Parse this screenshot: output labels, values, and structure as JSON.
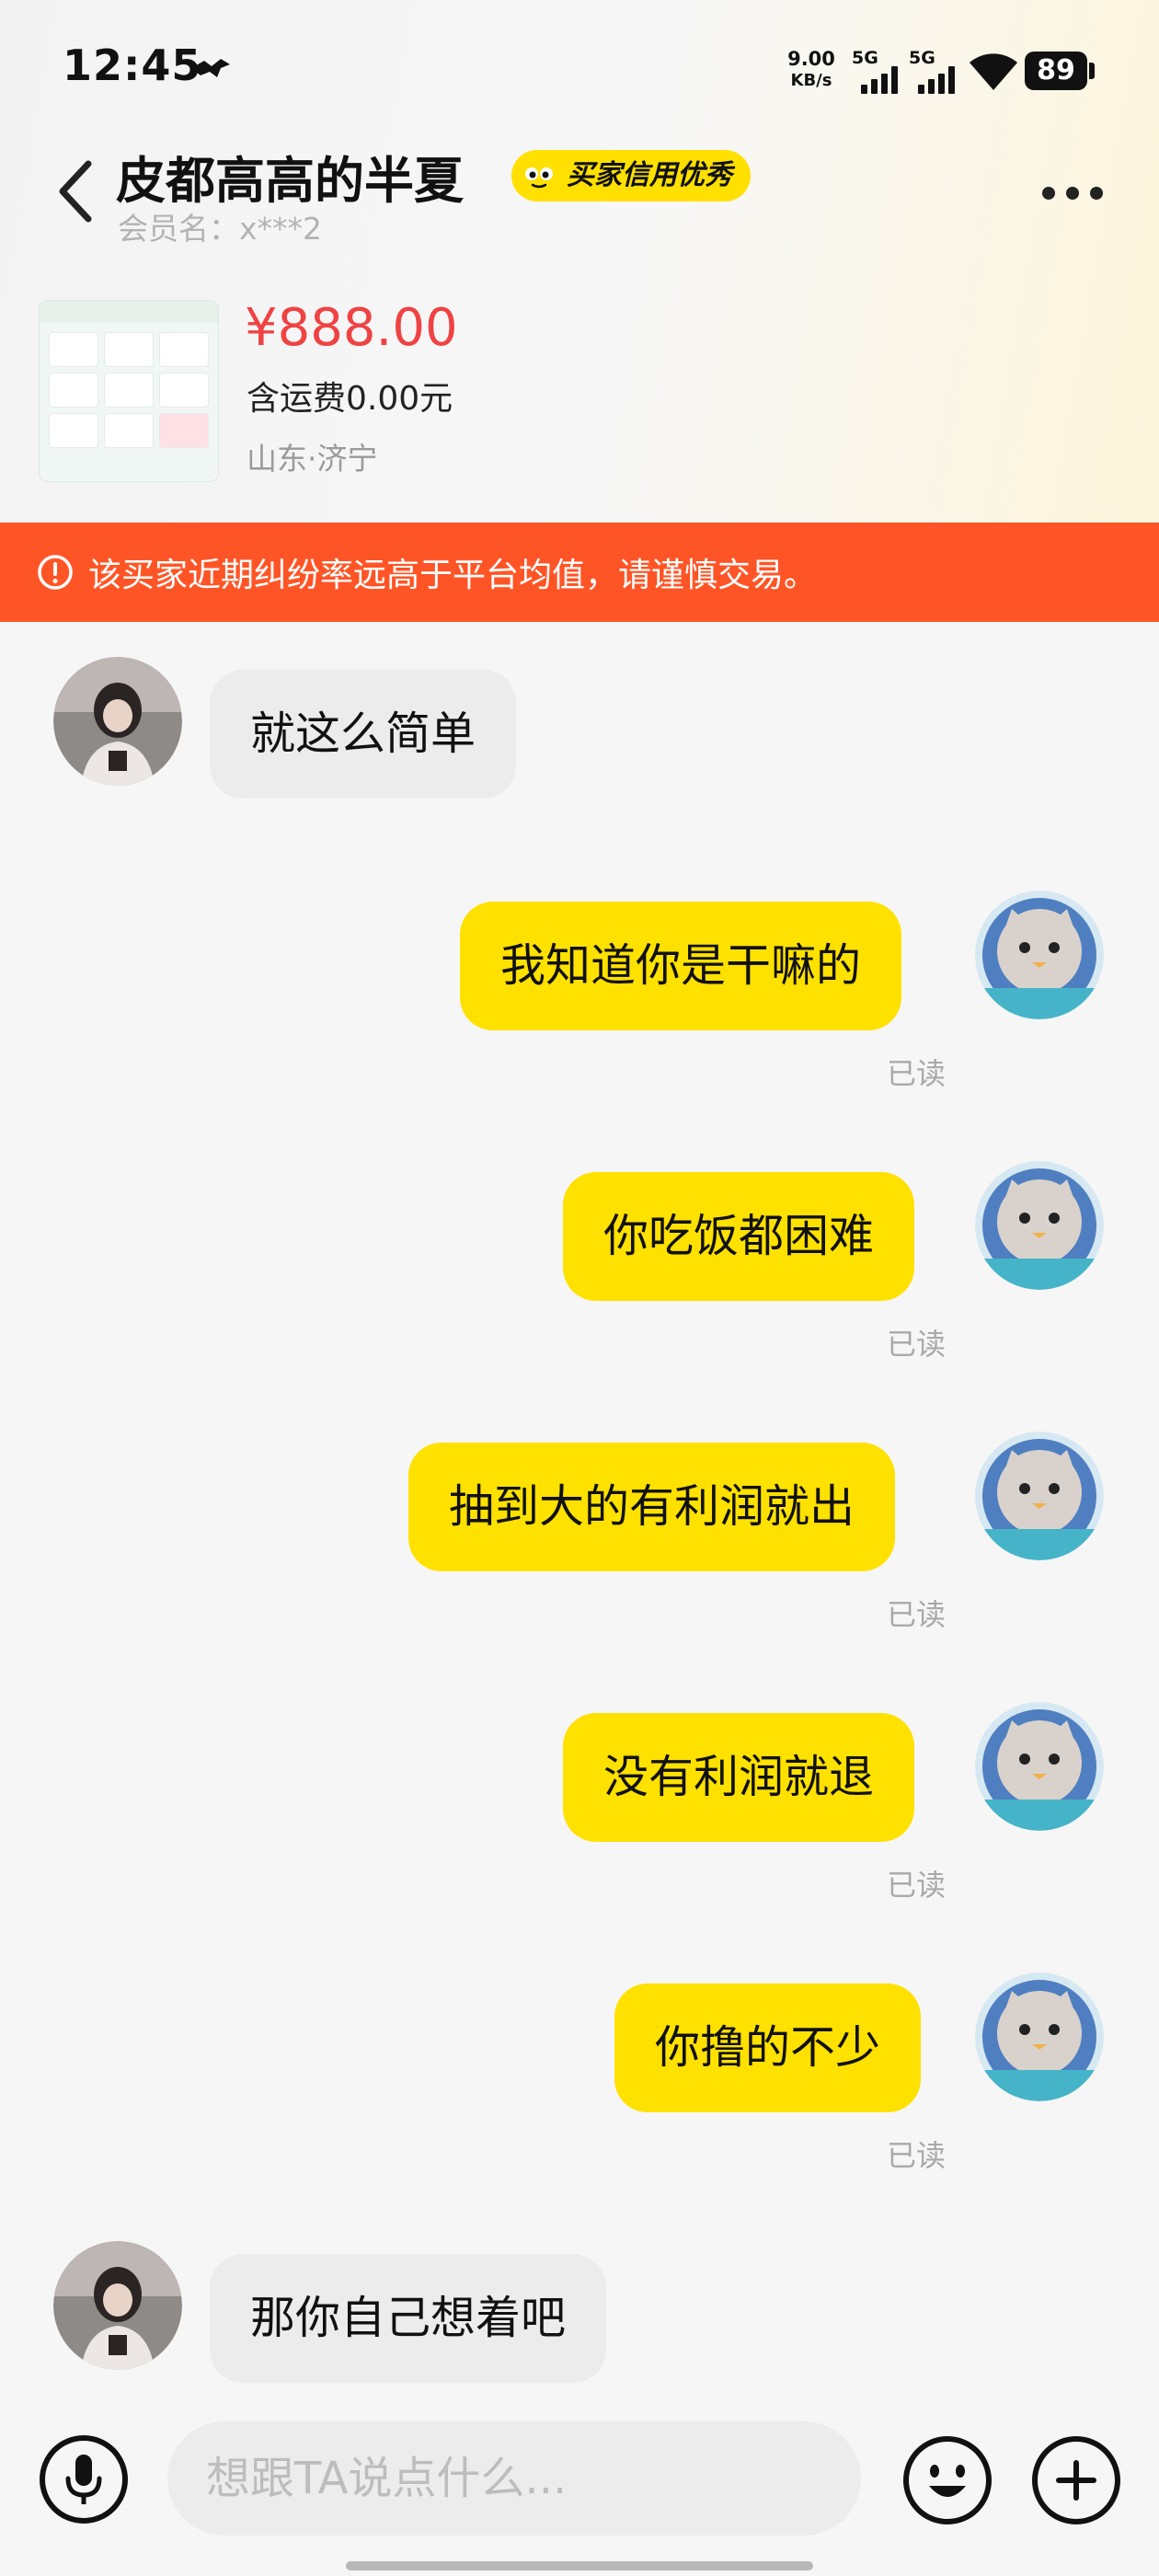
{
  "status_bar": {
    "time": "12:45",
    "net_speed_value": "9.00",
    "net_speed_unit": "KB/s",
    "signal1_label": "5G",
    "signal2_label": "5G",
    "battery": "89"
  },
  "nav": {
    "title": "皮都高高的半夏",
    "credit_badge": "买家信用优秀",
    "member_name": "会员名：x***2"
  },
  "product": {
    "price": "¥888.00",
    "shipping": "含运费0.00元",
    "location": "山东·济宁"
  },
  "warning": {
    "text": "该买家近期纠纷率远高于平台均值，请谨慎交易。"
  },
  "messages": [
    {
      "side": "in",
      "text": "就这么简单"
    },
    {
      "side": "out",
      "text": "我知道你是干嘛的",
      "status": "已读"
    },
    {
      "side": "out",
      "text": "你吃饭都困难",
      "status": "已读"
    },
    {
      "side": "out",
      "text": "抽到大的有利润就出",
      "status": "已读"
    },
    {
      "side": "out",
      "text": "没有利润就退",
      "status": "已读"
    },
    {
      "side": "out",
      "text": "你撸的不少",
      "status": "已读"
    },
    {
      "side": "in",
      "text": "那你自己想着吧"
    }
  ],
  "input": {
    "placeholder": "想跟TA说点什么..."
  },
  "colors": {
    "accent_yellow": "#ffe100",
    "price_red": "#ef4343",
    "warning_orange": "#ff5526"
  },
  "icons": {
    "back": "chevron-left-icon",
    "more": "more-dots-icon",
    "mic": "microphone-icon",
    "emoji": "smiley-icon",
    "plus": "plus-circle-icon"
  }
}
